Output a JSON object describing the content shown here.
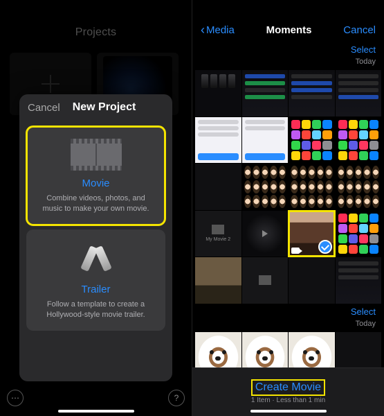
{
  "left": {
    "header": "Projects",
    "sheet": {
      "cancel": "Cancel",
      "title": "New Project",
      "options": [
        {
          "title": "Movie",
          "desc": "Combine videos, photos, and music to make your own movie."
        },
        {
          "title": "Trailer",
          "desc": "Follow a template to create a Hollywood-style movie trailer."
        }
      ]
    },
    "more_icon": "⋯",
    "help_icon": "?"
  },
  "right": {
    "nav": {
      "back": "Media",
      "title": "Moments",
      "cancel": "Cancel"
    },
    "sections": [
      {
        "select": "Select",
        "day": "Today"
      },
      {
        "select": "Select",
        "day": "Today"
      }
    ],
    "footer": {
      "create": "Create Movie",
      "meta": "1 Item · Less than 1 min"
    },
    "movie_caption": "My Movie 2"
  },
  "app_colors": [
    "#ff2d55",
    "#ffd60a",
    "#30d158",
    "#0a84ff",
    "#bf5af2",
    "#ff453a",
    "#64d2ff",
    "#ff9f0a",
    "#32d74b",
    "#5e5ce6",
    "#ff375f",
    "#8e8e93",
    "#ffd60a",
    "#ff453a",
    "#30d158",
    "#0a84ff"
  ]
}
